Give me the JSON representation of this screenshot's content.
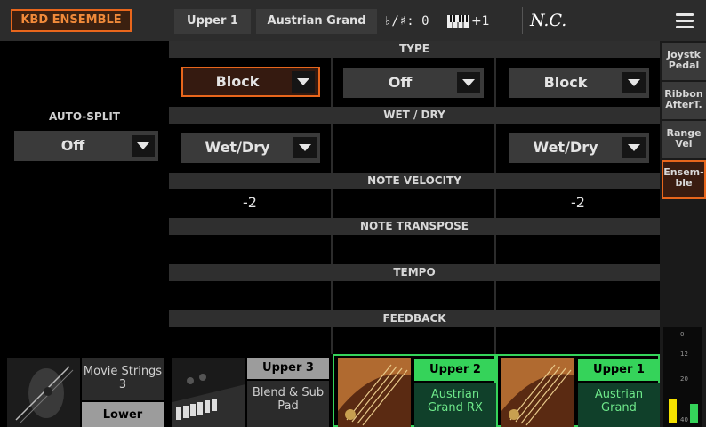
{
  "header": {
    "page_title": "KBD ENSEMBLE",
    "part_tab": "Upper 1",
    "sound_tab": "Austrian Grand",
    "key_signature": "♭/♯: 0",
    "octave_transpose": "+1",
    "chord": "N.C."
  },
  "left": {
    "auto_split_label": "AUTO-SPLIT",
    "auto_split_value": "Off"
  },
  "sections": {
    "type": "TYPE",
    "wet_dry": "WET / DRY",
    "note_velocity": "NOTE VELOCITY",
    "note_transpose": "NOTE TRANSPOSE",
    "tempo": "TEMPO",
    "feedback": "FEEDBACK"
  },
  "columns": [
    {
      "type": "Block",
      "wet_dry": "Wet/Dry",
      "velocity": "-2"
    },
    {
      "type": "Off",
      "wet_dry": "",
      "velocity": ""
    },
    {
      "type": "Block",
      "wet_dry": "Wet/Dry",
      "velocity": "-2"
    }
  ],
  "side_tabs": [
    {
      "label": "Joystk Pedal"
    },
    {
      "label": "Ribbon AfterT."
    },
    {
      "label": "Range Vel"
    },
    {
      "label": "Ensem- ble"
    }
  ],
  "meter": {
    "ticks": [
      "0",
      "12",
      "20",
      "40"
    ],
    "level_left": 0.28,
    "level_right": 0.22
  },
  "tracks": [
    {
      "name": "Movie Strings 3",
      "role": "Lower"
    },
    {
      "name": "Upper 3",
      "sound": "Blend & Sub Pad"
    },
    {
      "name": "Upper 2",
      "sound": "Austrian Grand RX"
    },
    {
      "name": "Upper 1",
      "sound": "Austrian Grand"
    }
  ],
  "colors": {
    "accent": "#e8661c",
    "active_green": "#35d35a",
    "header_bg": "#2c2c2c"
  }
}
